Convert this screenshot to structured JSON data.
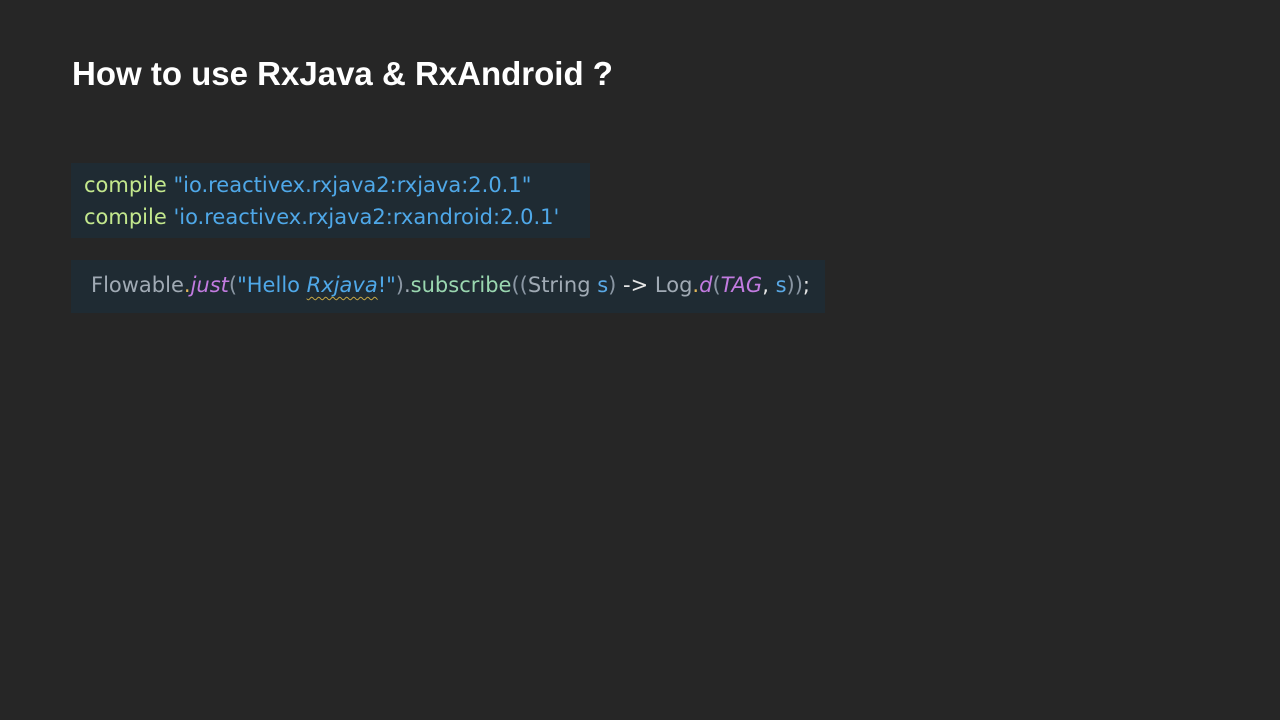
{
  "slide": {
    "title": "How to use RxJava & RxAndroid ?"
  },
  "gradle_block": {
    "lines": [
      {
        "keyword": "compile",
        "string": "\"io.reactivex.rxjava2:rxjava:2.0.1\""
      },
      {
        "keyword": "compile",
        "string": "'io.reactivex.rxjava2:rxandroid:2.0.1'"
      }
    ]
  },
  "java_block": {
    "tokens": {
      "class_name": "Flowable",
      "dot1": ".",
      "static_method": "just",
      "open_paren1": "(",
      "string_start": "\"Hello ",
      "string_word": "Rxjava",
      "string_end": "!\"",
      "close_paren1": ")",
      "dot2": ".",
      "method": "subscribe",
      "open_paren2": "((",
      "param_type": "String ",
      "param_name": "s",
      "close_paren2": ")",
      "arrow": " -> ",
      "log_class": "Log",
      "dot3": ".",
      "log_method": "d",
      "open_paren3": "(",
      "tag_const": "TAG",
      "comma": ", ",
      "arg_s": "s",
      "close_parens": "))",
      "semicolon": ";"
    }
  }
}
